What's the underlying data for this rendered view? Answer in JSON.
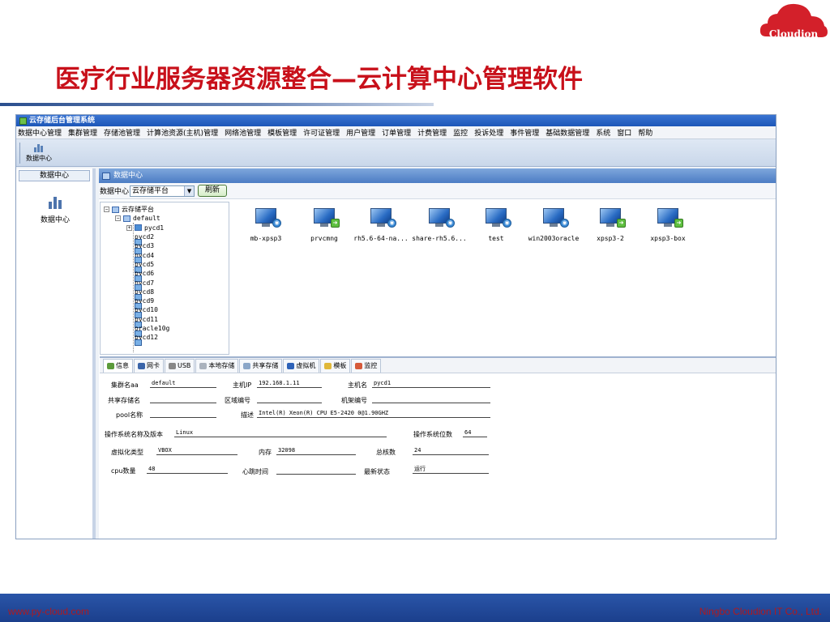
{
  "slide": {
    "title_part1": "医疗行业",
    "title_part2": "服务器资源整合—云计算中心管理软件",
    "footer_left": "www.py-cloud.com",
    "footer_right": "Ningbo Cloudion IT Co., Ltd.",
    "logo_text": "Cloudion",
    "colors": {
      "title_red": "#c8101a",
      "footer_blue": "#1b3f8c",
      "logo_red": "#d3202a"
    }
  },
  "app": {
    "window_title": "云存储后台管理系统",
    "menu": [
      "数据中心管理",
      "集群管理",
      "存储池管理",
      "计算池资源(主机)管理",
      "网络池管理",
      "模板管理",
      "许可证管理",
      "用户管理",
      "订单管理",
      "计费管理",
      "监控",
      "投诉处理",
      "事件管理",
      "基础数据管理",
      "系统",
      "窗口",
      "帮助"
    ],
    "toolbar": {
      "datacenter_button": "数据中心"
    },
    "leftnav": {
      "header": "数据中心",
      "item_label": "数据中心"
    },
    "panel": {
      "title": "数据中心",
      "selector_label": "数据中心",
      "selector_value": "云存储平台",
      "refresh_button": "刷新"
    },
    "tree": {
      "root": "云存储平台",
      "cluster": "default",
      "hosts": [
        "pycd1",
        "pycd2",
        "pycd3",
        "pycd4",
        "pycd5",
        "pycd6",
        "pycd7",
        "pycd8",
        "pycd9",
        "pycd10",
        "pycd11",
        "oracle10g",
        "pycd12"
      ]
    },
    "vms": [
      {
        "name": "mb-xpsp3",
        "badge": "info"
      },
      {
        "name": "prvcmng",
        "badge": "arrow"
      },
      {
        "name": "rh5.6-64-na...",
        "badge": "info"
      },
      {
        "name": "share-rh5.6...",
        "badge": "info"
      },
      {
        "name": "test",
        "badge": "info"
      },
      {
        "name": "win2003oracle",
        "badge": "info"
      },
      {
        "name": "xpsp3-2",
        "badge": "arrow"
      },
      {
        "name": "xpsp3-box",
        "badge": "arrow"
      }
    ],
    "tabs": [
      "信息",
      "网卡",
      "USB",
      "本地存储",
      "共享存储",
      "虚拟机",
      "模板",
      "监控"
    ],
    "info": {
      "cluster_name_label": "集群名aa",
      "cluster_name_value": "default",
      "host_ip_label": "主机IP",
      "host_ip_value": "192.168.1.11",
      "host_name_label": "主机名",
      "host_name_value": "pycd1",
      "shared_storage_label": "共享存储名",
      "shared_storage_value": "",
      "zone_code_label": "区域编号",
      "zone_code_value": "",
      "rack_code_label": "机架编号",
      "rack_code_value": "",
      "pool_name_label": "pool名称",
      "pool_name_value": "",
      "desc_label": "描述",
      "desc_value": "Intel(R) Xeon(R) CPU E5-2420 0@1.90GHZ",
      "os_name_label": "操作系统名称及版本",
      "os_name_value": "Linux",
      "os_bits_label": "操作系统位数",
      "os_bits_value": "64",
      "virt_type_label": "虚拟化类型",
      "virt_type_value": "VBOX",
      "memory_label": "内存",
      "memory_value": "32098",
      "cores_label": "总核数",
      "cores_value": "24",
      "cpu_count_label": "cpu数量",
      "cpu_count_value": "48",
      "heartbeat_label": "心跳时间",
      "heartbeat_value": "",
      "status_label": "最新状态",
      "status_value": "运行"
    }
  }
}
